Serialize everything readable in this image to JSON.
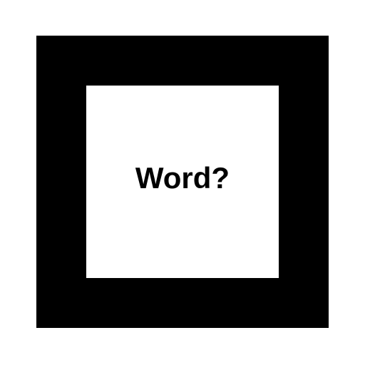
{
  "card": {
    "text": "Word?",
    "frame_color": "#000000",
    "background_color": "#ffffff",
    "text_color": "#000000"
  }
}
